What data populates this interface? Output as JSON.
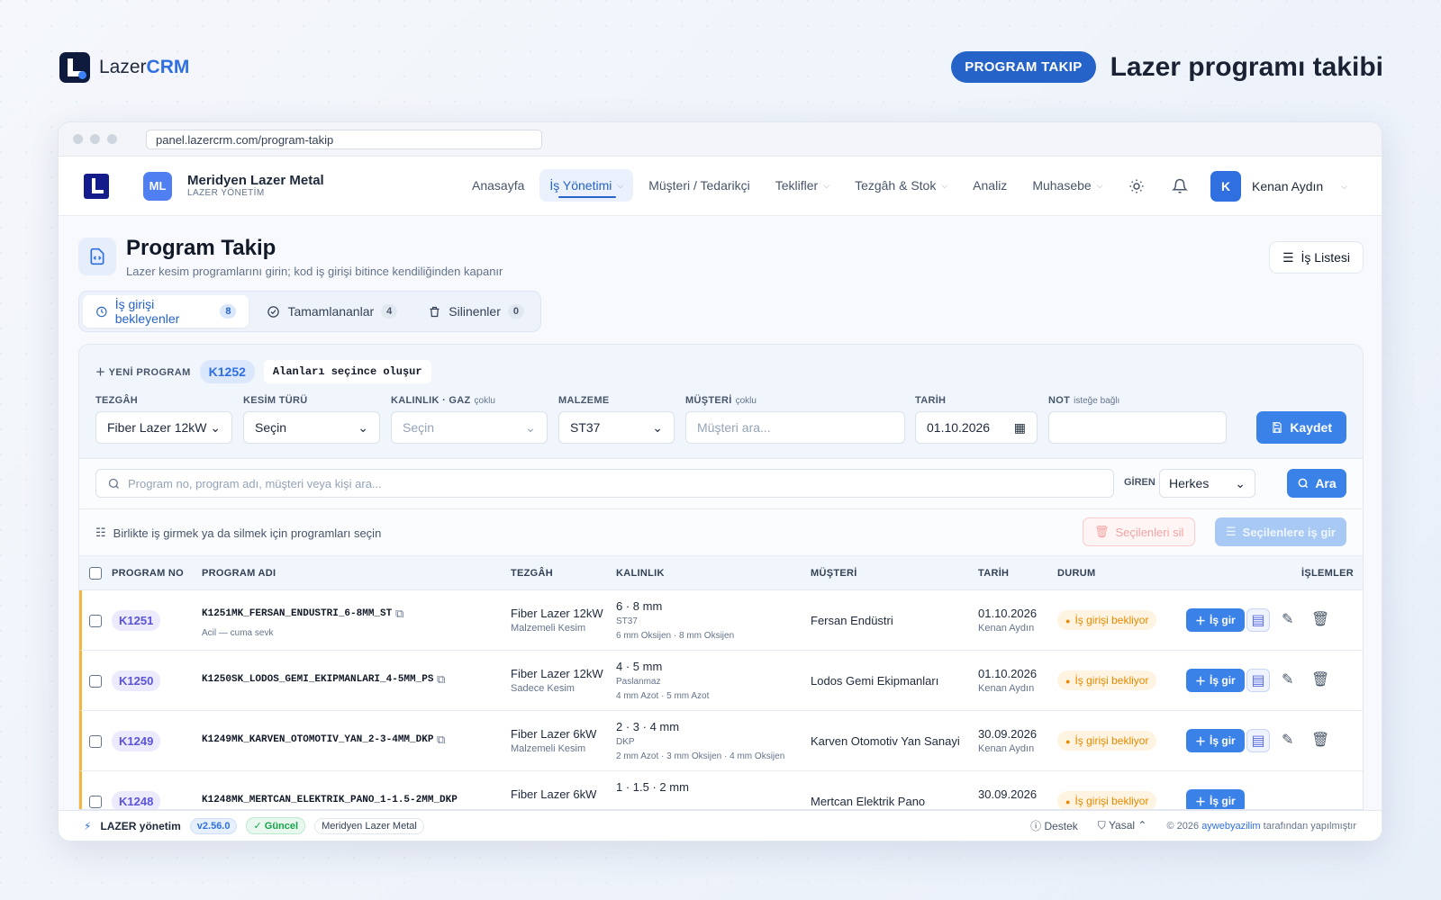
{
  "brand": {
    "name_prefix": "Lazer",
    "name_suffix": "CRM"
  },
  "hero": {
    "badge": "PROGRAM TAKIP",
    "title": "Lazer programı takibi"
  },
  "browser": {
    "url": "panel.lazercrm.com/program-takip"
  },
  "company": {
    "initials": "ML",
    "name": "Meridyen Lazer Metal",
    "subtitle": "LAZER YÖNETİM"
  },
  "menu": [
    {
      "label": "Anasayfa",
      "dropdown": false
    },
    {
      "label": "İş Yönetimi",
      "dropdown": true,
      "active": true
    },
    {
      "label": "Müşteri / Tedarikçi",
      "dropdown": false
    },
    {
      "label": "Teklifler",
      "dropdown": true
    },
    {
      "label": "Tezgâh & Stok",
      "dropdown": true
    },
    {
      "label": "Analiz",
      "dropdown": false
    },
    {
      "label": "Muhasebe",
      "dropdown": true
    }
  ],
  "user": {
    "initial": "K",
    "name": "Kenan Aydın"
  },
  "page": {
    "title": "Program Takip",
    "subtitle": "Lazer kesim programlarını girin; kod iş girişi bitince kendiliğinden kapanır",
    "list_button": "İş Listesi"
  },
  "tabs": [
    {
      "label": "İş girişi bekleyenler",
      "count": "8"
    },
    {
      "label": "Tamamlananlar",
      "count": "4"
    },
    {
      "label": "Silinenler",
      "count": "0"
    }
  ],
  "form": {
    "new_label": "YENİ PROGRAM",
    "code": "K1252",
    "hint": "Alanları seçince oluşur",
    "tezgah": {
      "label": "TEZGÂH",
      "value": "Fiber Lazer 12kW"
    },
    "kesim": {
      "label": "KESİM TÜRÜ",
      "value": "Seçin"
    },
    "kalinlik": {
      "label": "KALINLIK · GAZ",
      "note": "çoklu",
      "value": "Seçin"
    },
    "malzeme": {
      "label": "MALZEME",
      "value": "ST37"
    },
    "musteri": {
      "label": "MÜŞTERİ",
      "note": "çoklu",
      "placeholder": "Müşteri ara..."
    },
    "tarih": {
      "label": "TARİH",
      "value": "01.10.2026"
    },
    "not": {
      "label": "NOT",
      "note": "isteğe bağlı"
    },
    "save": "Kaydet"
  },
  "search": {
    "placeholder": "Program no, program adı, müşteri veya kişi ara...",
    "giren_label": "GİREN",
    "giren_value": "Herkes",
    "button": "Ara"
  },
  "bulk": {
    "hint": "Birlikte iş girmek ya da silmek için programları seçin",
    "delete": "Seçilenleri sil",
    "enter": "Seçilenlere iş gir"
  },
  "table": {
    "headers": {
      "no": "PROGRAM NO",
      "name": "PROGRAM ADI",
      "tezgah": "TEZGÂH",
      "kalinlik": "KALINLIK",
      "musteri": "MÜŞTERİ",
      "tarih": "TARİH",
      "durum": "DURUM",
      "islem": "İŞLEMLER"
    },
    "action_label": "İş gir",
    "rows": [
      {
        "code": "K1251",
        "name": "K1251MK_FERSAN_ENDUSTRI_6-8MM_ST",
        "note": "Acil — cuma sevk",
        "tezgah": "Fiber Lazer 12kW",
        "kesim": "Malzemeli Kesim",
        "kalinlik": "6 · 8 mm",
        "malzeme": "ST37",
        "gaz": "6 mm Oksijen · 8 mm Oksijen",
        "musteri": "Fersan Endüstri",
        "tarih": "01.10.2026",
        "kisi": "Kenan Aydın",
        "durum": "İş girişi bekliyor"
      },
      {
        "code": "K1250",
        "name": "K1250SK_LODOS_GEMI_EKIPMANLARI_4-5MM_PS",
        "note": "",
        "tezgah": "Fiber Lazer 12kW",
        "kesim": "Sadece Kesim",
        "kalinlik": "4 · 5 mm",
        "malzeme": "Paslanmaz",
        "gaz": "4 mm Azot · 5 mm Azot",
        "musteri": "Lodos Gemi Ekipmanları",
        "tarih": "01.10.2026",
        "kisi": "Kenan Aydın",
        "durum": "İş girişi bekliyor"
      },
      {
        "code": "K1249",
        "name": "K1249MK_KARVEN_OTOMOTIV_YAN_2-3-4MM_DKP",
        "note": "",
        "tezgah": "Fiber Lazer 6kW",
        "kesim": "Malzemeli Kesim",
        "kalinlik": "2 · 3 · 4 mm",
        "malzeme": "DKP",
        "gaz": "2 mm Azot · 3 mm Oksijen · 4 mm Oksijen",
        "musteri": "Karven Otomotiv Yan Sanayi",
        "tarih": "30.09.2026",
        "kisi": "Kenan Aydın",
        "durum": "İş girişi bekliyor"
      },
      {
        "code": "K1248",
        "name": "K1248MK_MERTCAN_ELEKTRIK_PANO_1-1.5-2MM_DKP",
        "note": "",
        "tezgah": "Fiber Lazer 6kW",
        "kesim": "",
        "kalinlik": "1 · 1.5 · 2 mm",
        "malzeme": "",
        "gaz": "",
        "musteri": "Mertcan Elektrik Pano",
        "tarih": "30.09.2026",
        "kisi": "",
        "durum": "İş girişi bekliyor"
      }
    ]
  },
  "footer": {
    "brand": "LAZER yönetim",
    "version": "v2.56.0",
    "status": "Güncel",
    "company": "Meridyen Lazer Metal",
    "support": "Destek",
    "legal": "Yasal",
    "copyright_pre": "© 2026",
    "copyright_link": "aywebyazilim",
    "copyright_post": "tarafından yapılmıştır"
  }
}
